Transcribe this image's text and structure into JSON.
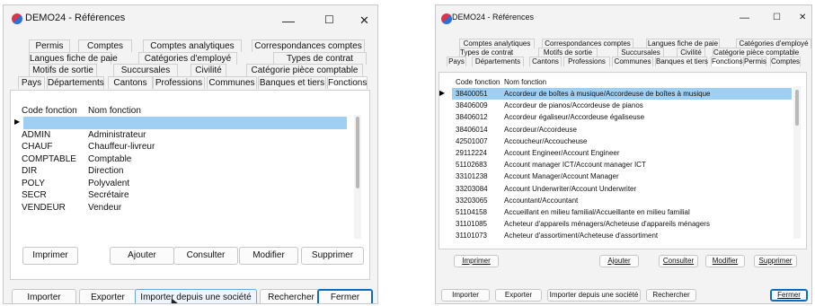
{
  "left": {
    "title": "DEMO24 - Références",
    "controls": {
      "minimize": "—",
      "maximize": "☐",
      "close": "✕"
    },
    "tab_rows": [
      [
        "Permis",
        "Comptes",
        "Comptes analytiques",
        "Correspondances comptes"
      ],
      [
        "Langues fiche de paie",
        "Catégories d'employé",
        "Types de contrat"
      ],
      [
        "Motifs de sortie",
        "Succursales",
        "Civilité",
        "Catégorie pièce comptable"
      ],
      [
        "Pays",
        "Départements",
        "Cantons",
        "Professions",
        "Communes",
        "Banques et tiers",
        "Fonctions"
      ]
    ],
    "active_tab": "Fonctions",
    "columns": [
      "Code fonction",
      "Nom fonction"
    ],
    "rows": [
      [
        "",
        ""
      ],
      [
        "ADMIN",
        "Administrateur"
      ],
      [
        "CHAUF",
        "Chauffeur-livreur"
      ],
      [
        "COMPTABLE",
        "Comptable"
      ],
      [
        "DIR",
        "Direction"
      ],
      [
        "POLY",
        "Polyvalent"
      ],
      [
        "SECR",
        "Secrétaire"
      ],
      [
        "VENDEUR",
        "Vendeur"
      ]
    ],
    "actions": [
      "Imprimer",
      "Ajouter",
      "Consulter",
      "Modifier",
      "Supprimer"
    ],
    "bottom": [
      "Importer",
      "Exporter",
      "Importer depuis une société",
      "Rechercher",
      "Fermer"
    ]
  },
  "right": {
    "title": "DEMO24 - Références",
    "controls": {
      "minimize": "—",
      "maximize": "☐",
      "close": "✕"
    },
    "tab_rows": [
      [
        "Comptes analytiques",
        "Correspondances comptes",
        "Langues fiche de paie",
        "Catégories d'employé"
      ],
      [
        "Types de contrat",
        "Motifs de sortie",
        "Succursales",
        "Civilité",
        "Catégorie pièce comptable"
      ],
      [
        "Pays",
        "Départements",
        "Cantons",
        "Professions",
        "Communes",
        "Banques et tiers",
        "Fonctions",
        "Permis",
        "Comptes"
      ]
    ],
    "active_tab": "Fonctions",
    "columns": [
      "Code fonction",
      "Nom fonction"
    ],
    "rows": [
      [
        "38400051",
        "Accordeur de boîtes à musique/Accordeuse de boîtes à musique"
      ],
      [
        "38406009",
        "Accordeur de pianos/Accordeuse de pianos"
      ],
      [
        "38406012",
        "Accordeur égaliseur/Accordeuse égaliseuse"
      ],
      [
        "38406014",
        "Accordeur/Accordeuse"
      ],
      [
        "42501007",
        "Accoucheur/Accoucheuse"
      ],
      [
        "29112224",
        "Account Engineer/Account Engineer"
      ],
      [
        "51102683",
        "Account manager ICT/Account manager ICT"
      ],
      [
        "33101238",
        "Account Manager/Account Manager"
      ],
      [
        "33203084",
        "Account Underwriter/Account Underwriter"
      ],
      [
        "33203065",
        "Accountant/Accountant"
      ],
      [
        "51104158",
        "Accueillant en milieu familial/Accueillante en milieu familial"
      ],
      [
        "31101085",
        "Acheteur d'appareils ménagers/Acheteuse d'appareils ménagers"
      ],
      [
        "31101073",
        "Acheteur d'assortiment/Acheteuse d'assortiment"
      ]
    ],
    "actions": [
      "Imprimer",
      "Ajouter",
      "Consulter",
      "Modifier",
      "Supprimer"
    ],
    "bottom": [
      "Importer",
      "Exporter",
      "Importer depuis une société",
      "Rechercher",
      "Fermer"
    ]
  }
}
